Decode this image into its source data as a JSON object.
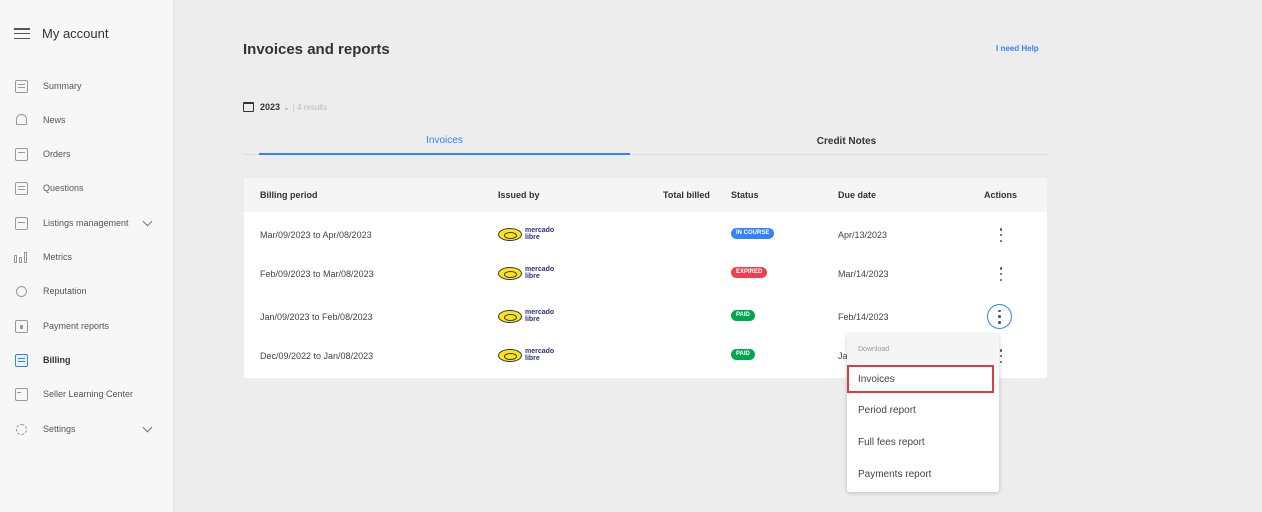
{
  "sidebar": {
    "title": "My account",
    "items": [
      {
        "label": "Summary"
      },
      {
        "label": "News"
      },
      {
        "label": "Orders"
      },
      {
        "label": "Questions"
      },
      {
        "label": "Listings management"
      },
      {
        "label": "Metrics"
      },
      {
        "label": "Reputation"
      },
      {
        "label": "Payment reports"
      },
      {
        "label": "Billing",
        "active": true
      },
      {
        "label": "Seller Learning Center"
      },
      {
        "label": "Settings"
      }
    ]
  },
  "header": {
    "title": "Invoices and reports",
    "help": "I need Help"
  },
  "filter": {
    "year": "2023",
    "results": "| 4 results"
  },
  "tabs": {
    "invoices": "Invoices",
    "credit_notes": "Credit Notes"
  },
  "table": {
    "headers": {
      "billing_period": "Billing period",
      "issued_by": "Issued by",
      "total_billed": "Total billed",
      "status": "Status",
      "due_date": "Due date",
      "actions": "Actions"
    },
    "issuer_logo_line1": "mercado",
    "issuer_logo_line2": "libre",
    "rows": [
      {
        "period": "Mar/09/2023 to Apr/08/2023",
        "status": "IN COURSE",
        "due": "Apr/13/2023"
      },
      {
        "period": "Feb/09/2023 to Mar/08/2023",
        "status": "EXPIRED",
        "due": "Mar/14/2023"
      },
      {
        "period": "Jan/09/2023 to Feb/08/2023",
        "status": "PAID",
        "due": "Feb/14/2023"
      },
      {
        "period": "Dec/09/2022 to Jan/08/2023",
        "status": "PAID",
        "due": "Ja"
      }
    ]
  },
  "dropdown": {
    "header": "Download",
    "items": [
      "Invoices",
      "Period report",
      "Full fees report",
      "Payments report"
    ]
  },
  "colors": {
    "accent": "#3483fa",
    "expired": "#f23d4f",
    "paid": "#00a650",
    "highlight": "#e03c3c"
  }
}
